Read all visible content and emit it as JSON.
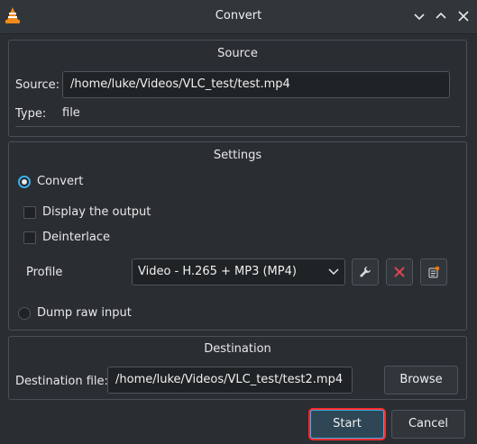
{
  "window": {
    "title": "Convert"
  },
  "source": {
    "group_title": "Source",
    "source_label": "Source:",
    "source_value": "/home/luke/Videos/VLC_test/test.mp4",
    "type_label": "Type:",
    "type_value": "file"
  },
  "settings": {
    "group_title": "Settings",
    "convert_label": "Convert",
    "display_output_label": "Display the output",
    "deinterlace_label": "Deinterlace",
    "profile_label": "Profile",
    "profile_value": "Video - H.265 + MP3 (MP4)",
    "dump_raw_label": "Dump raw input"
  },
  "destination": {
    "group_title": "Destination",
    "file_label": "Destination file:",
    "file_value": "/home/luke/Videos/VLC_test/test2.mp4",
    "browse_label": "Browse"
  },
  "buttons": {
    "start": "Start",
    "cancel": "Cancel"
  },
  "colors": {
    "accent": "#3daee9",
    "highlight": "#ff2a2a",
    "delete_red": "#da4453"
  }
}
